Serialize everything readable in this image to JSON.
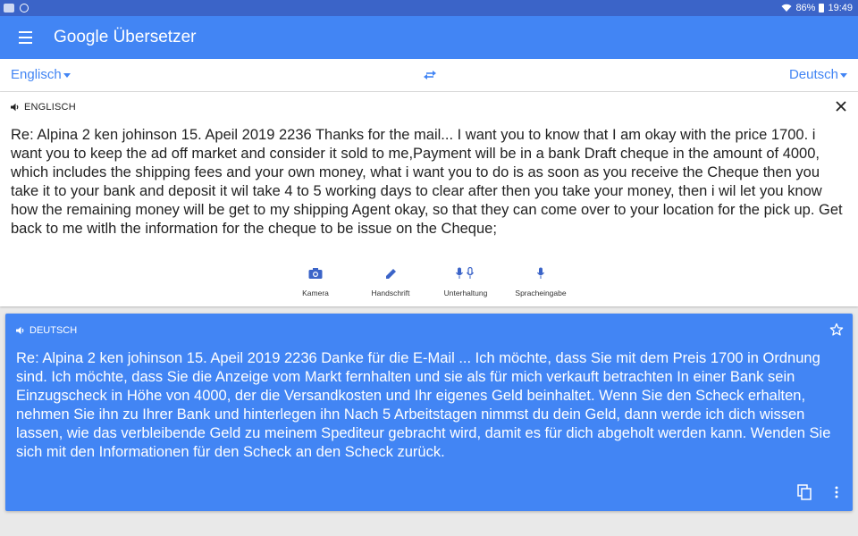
{
  "status_bar": {
    "battery": "86%",
    "time": "19:49",
    "icons": [
      "app-icon",
      "pinterest-icon",
      "wifi-icon",
      "battery-icon"
    ]
  },
  "app_bar": {
    "brand": "Google",
    "product": "Übersetzer",
    "icons": [
      "menu-icon"
    ]
  },
  "languages": {
    "source": "Englisch",
    "target": "Deutsch",
    "icons": [
      "swap-languages-icon"
    ]
  },
  "source_panel": {
    "label": "ENGLISCH",
    "text": "Re: Alpina 2 ken johinson 15. Apeil 2019 2236 Thanks for the mail... I want you to know that I am okay with the price 1700. i want you to keep the ad off market and consider it sold to me,Payment will be in a bank Draft cheque in the amount of 4000, which includes the shipping fees and your own money, what i want you to do is as soon as you receive the Cheque then you take it to your bank and deposit it wil take 4 to 5 working days to clear after then you take your money, then i wil let you know how the remaining money will be get to my shipping Agent okay, so that they can come over to your location for the pick up. Get back to me witlh the information for the cheque to be issue on the Cheque;",
    "icons": [
      "speaker-icon",
      "close-icon"
    ],
    "tools": [
      {
        "label": "Kamera",
        "icon": "camera-icon"
      },
      {
        "label": "Handschrift",
        "icon": "pen-icon"
      },
      {
        "label": "Unterhaltung",
        "icon": "conversation-mic-icon"
      },
      {
        "label": "Spracheingabe",
        "icon": "microphone-icon"
      }
    ]
  },
  "translation_card": {
    "label": "DEUTSCH",
    "text": "Re: Alpina 2 ken johinson 15. Apeil 2019 2236 Danke für die E-Mail ... Ich möchte, dass Sie mit dem Preis 1700 in Ordnung sind. Ich möchte, dass Sie die Anzeige vom Markt fernhalten und sie als für mich verkauft betrachten  In einer Bank sein Einzugscheck in Höhe von 4000, der die Versandkosten und Ihr eigenes Geld beinhaltet. Wenn Sie den Scheck erhalten, nehmen Sie ihn zu Ihrer Bank und hinterlegen ihn  Nach 5 Arbeitstagen nimmst du dein Geld, dann werde ich dich wissen lassen, wie das verbleibende Geld zu meinem Spediteur gebracht wird, damit es für dich abgeholt werden kann.  Wenden Sie sich mit den Informationen für den Scheck an den Scheck zurück.",
    "icons": [
      "speaker-icon",
      "star-icon",
      "copy-icon",
      "more-vert-icon"
    ]
  },
  "colors": {
    "primary": "#4285f4",
    "status_bar": "#3b64c8",
    "background": "#e9e9e9"
  }
}
